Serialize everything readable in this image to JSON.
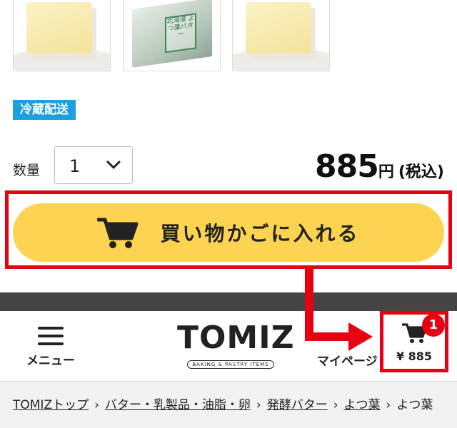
{
  "gallery": {
    "label_mid": "北海道 よつ葉バター"
  },
  "shipping_badge": "冷蔵配送",
  "quantity": {
    "label": "数量",
    "value": "1"
  },
  "price": {
    "amount": "885",
    "currency_suffix": "円",
    "tax_note": "(税込)"
  },
  "add_to_cart": {
    "label": "買い物かごに入れる",
    "icon": "cart-icon"
  },
  "header": {
    "menu_label": "メニュー",
    "logo_text": "TOMIZ",
    "logo_sub": "BAKING & PASTRY ITEMS",
    "mypage_label": "マイページ",
    "cart_count": "1",
    "cart_total": "¥ 885"
  },
  "breadcrumb": [
    "TOMIZトップ",
    "バター・乳製品・油脂・卵",
    "発酵バター",
    "よつ葉",
    "よつ葉"
  ],
  "colors": {
    "button_yellow": "#fdd452",
    "highlight_red": "#e60012",
    "badge_blue": "#1ca0e0",
    "bar_dark": "#444444"
  }
}
